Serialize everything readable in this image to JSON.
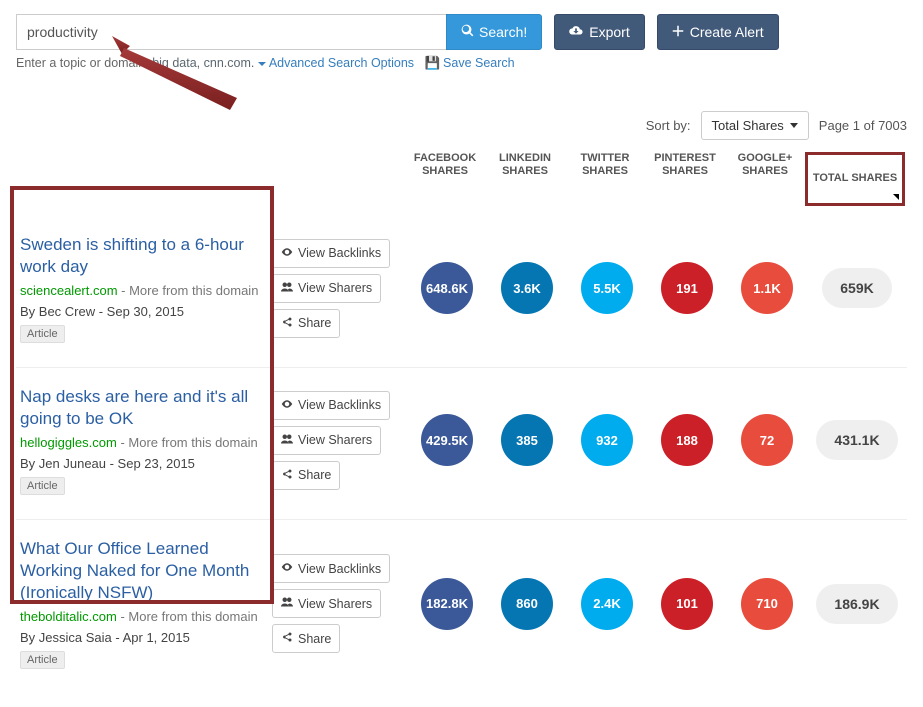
{
  "search": {
    "value": "productivity",
    "button": "Search!",
    "hint_prefix": "Enter a topic or domain: ",
    "hint_example": "big data, cnn.com. ",
    "adv_link": "Advanced Search Options",
    "save_link": "Save Search"
  },
  "top_buttons": {
    "export": "Export",
    "create_alert": "Create Alert"
  },
  "sort": {
    "label": "Sort by:",
    "value": "Total Shares",
    "page_info": "Page 1 of 7003"
  },
  "columns": {
    "facebook": "FACEBOOK\nSHARES",
    "linkedin": "LINKEDIN\nSHARES",
    "twitter": "TWITTER\nSHARES",
    "pinterest": "PINTEREST\nSHARES",
    "google": "GOOGLE+\nSHARES",
    "total": "TOTAL SHARES"
  },
  "actions": {
    "backlinks": "View Backlinks",
    "sharers": "View Sharers",
    "share": "Share"
  },
  "results": [
    {
      "title": "Sweden is shifting to a 6-hour work day",
      "domain": "sciencealert.com",
      "more": " - More from this domain",
      "byline": "By Bec Crew - Sep 30, 2015",
      "tag": "Article",
      "shares": {
        "facebook": "648.6K",
        "linkedin": "3.6K",
        "twitter": "5.5K",
        "pinterest": "191",
        "google": "1.1K",
        "total": "659K"
      }
    },
    {
      "title": "Nap desks are here and it's all going to be OK",
      "domain": "hellogiggles.com",
      "more": " - More from this domain",
      "byline": "By Jen Juneau - Sep 23, 2015",
      "tag": "Article",
      "shares": {
        "facebook": "429.5K",
        "linkedin": "385",
        "twitter": "932",
        "pinterest": "188",
        "google": "72",
        "total": "431.1K"
      }
    },
    {
      "title": "What Our Office Learned Working Naked for One Month (Ironically NSFW)",
      "domain": "thebolditalic.com",
      "more": " - More from this domain",
      "byline": "By Jessica Saia - Apr 1, 2015",
      "tag": "Article",
      "shares": {
        "facebook": "182.8K",
        "linkedin": "860",
        "twitter": "2.4K",
        "pinterest": "101",
        "google": "710",
        "total": "186.9K"
      }
    }
  ]
}
